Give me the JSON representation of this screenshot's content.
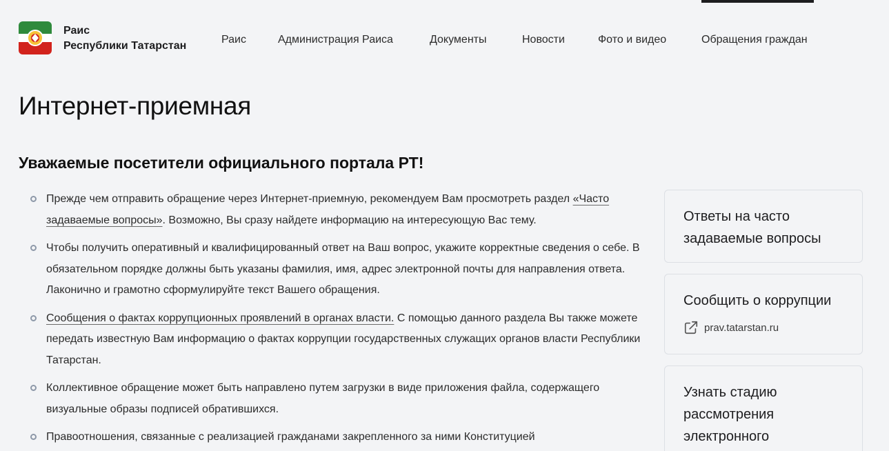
{
  "brand": {
    "line1": "Раис",
    "line2": "Республики Татарстан",
    "colors": {
      "green": "#2f8a3c",
      "red": "#d2231c",
      "white": "#ffffff"
    }
  },
  "nav": {
    "items": [
      {
        "label": "Раис"
      },
      {
        "label": "Администрация Раиса"
      },
      {
        "label": "Документы"
      },
      {
        "label": "Новости"
      },
      {
        "label": "Фото и видео"
      },
      {
        "label": "Обращения граждан"
      }
    ],
    "active": "Обращения граждан"
  },
  "page": {
    "title": "Интернет-приемная",
    "subtitle": "Уважаемые посетители официального портала РТ!"
  },
  "notes": [
    {
      "pre": "Прежде чем отправить обращение через Интернет-приемную, рекомендуем Вам просмотреть раздел ",
      "link": "«Часто задаваемые вопросы»",
      "post": ". Возможно, Вы сразу найдете информацию на интересующую Вас тему."
    },
    {
      "pre": "Чтобы получить оперативный и квалифицированный ответ на Ваш вопрос, укажите корректные сведения о себе. В обязательном порядке должны быть указаны фамилия, имя, адрес электронной почты для направления ответа. Лаконично и грамотно сформулируйте текст Вашего обращения.",
      "link": "",
      "post": ""
    },
    {
      "pre": "",
      "link": "Сообщения о фактах коррупционных проявлений в органах власти.",
      "post": " С помощью данного раздела Вы также можете передать известную Вам информацию о фактах коррупции государственных служащих органов власти Республики Татарстан."
    },
    {
      "pre": "Коллективное обращение может быть направлено путем загрузки в виде приложения файла, содержащего визуальные образы подписей обратившихся.",
      "link": "",
      "post": ""
    },
    {
      "pre": "Правоотношения, связанные с реализацией гражданами закрепленного за ними Конституцией",
      "link": "",
      "post": ""
    }
  ],
  "sidebar": {
    "faq_card": {
      "title": "Ответы на часто задаваемые вопросы"
    },
    "corruption_card": {
      "title": "Сообщить о коррупции",
      "link_text": "prav.tatarstan.ru",
      "icon": "external-link-icon"
    },
    "status_card": {
      "title": "Узнать стадию рассмотрения электронного"
    }
  }
}
